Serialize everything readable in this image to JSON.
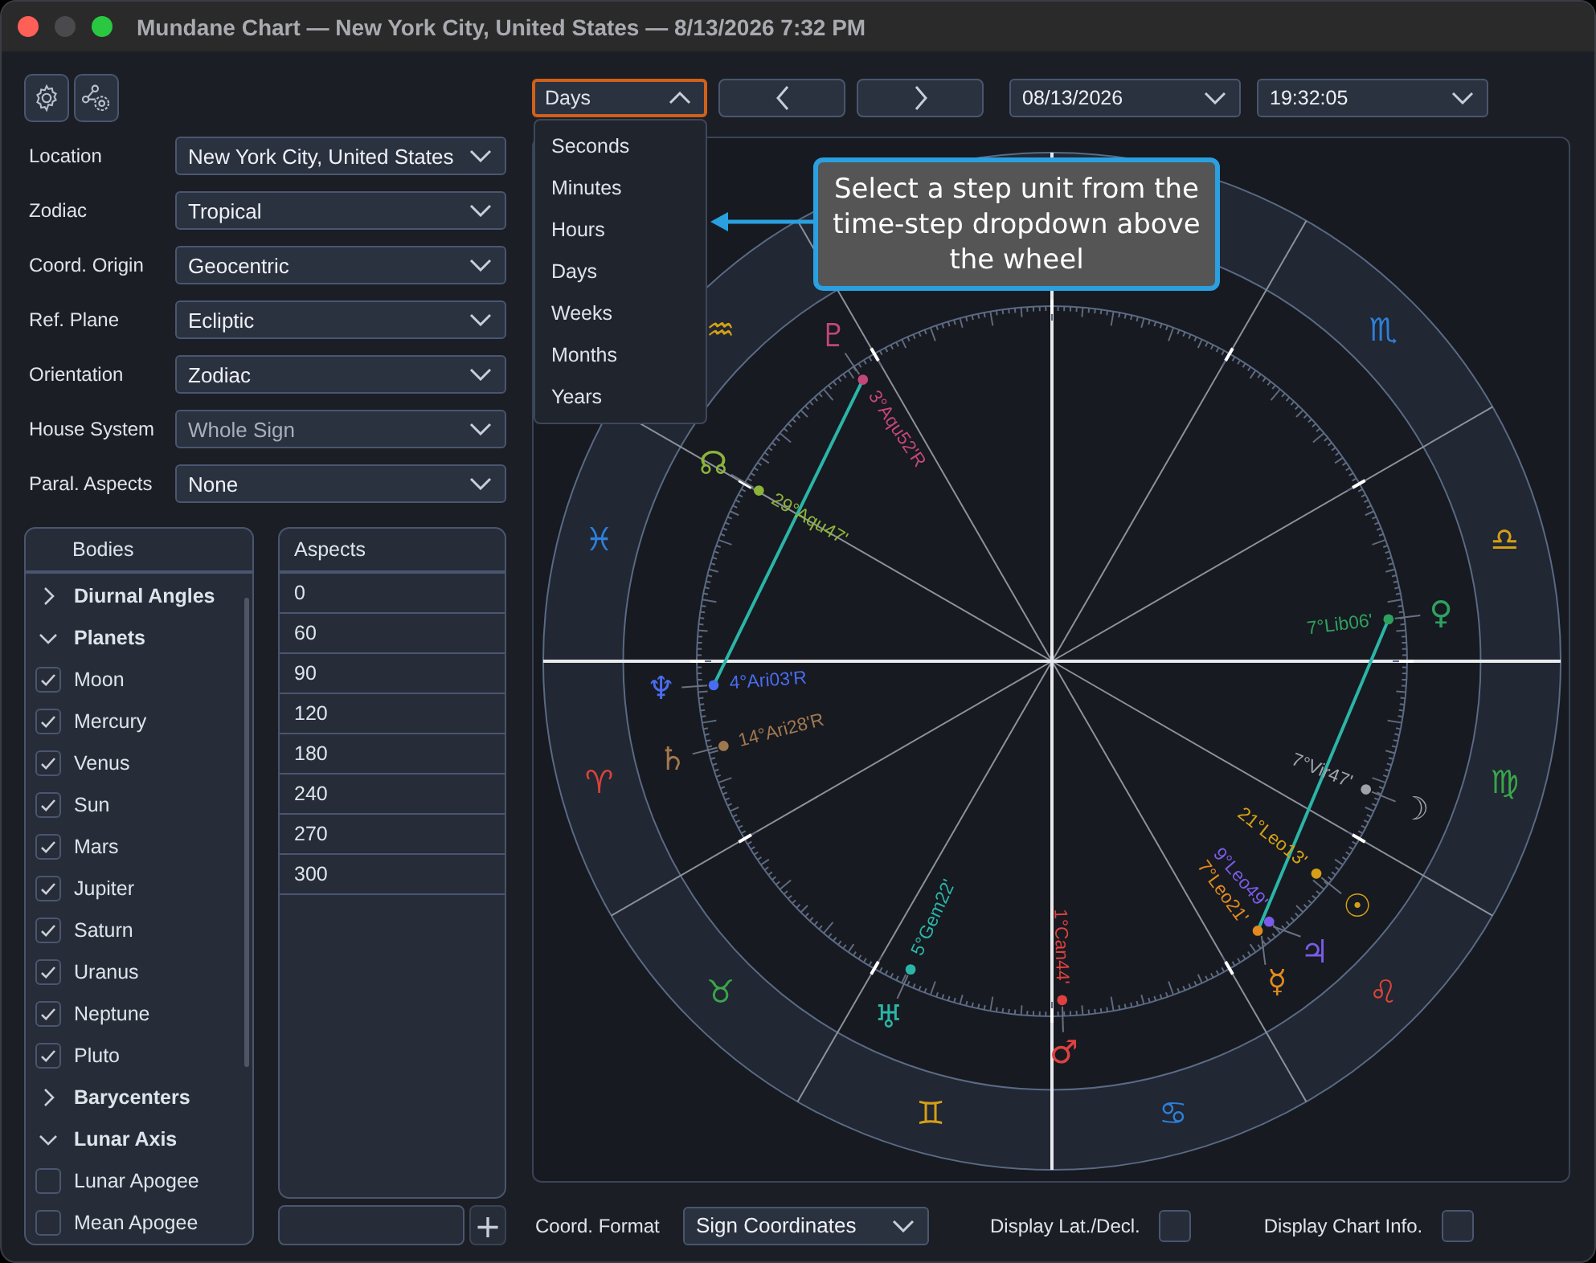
{
  "window": {
    "title": "Mundane Chart — New York City, United States — 8/13/2026 7:32 PM"
  },
  "form": [
    {
      "label": "Location",
      "value": "New York City, United States",
      "disabled": false
    },
    {
      "label": "Zodiac",
      "value": "Tropical",
      "disabled": false
    },
    {
      "label": "Coord. Origin",
      "value": "Geocentric",
      "disabled": false
    },
    {
      "label": "Ref. Plane",
      "value": "Ecliptic",
      "disabled": false
    },
    {
      "label": "Orientation",
      "value": "Zodiac",
      "disabled": false
    },
    {
      "label": "House System",
      "value": "Whole Sign",
      "disabled": true
    },
    {
      "label": "Paral. Aspects",
      "value": "None",
      "disabled": false
    }
  ],
  "bodies": {
    "title": "Bodies",
    "groups": [
      {
        "label": "Diurnal Angles",
        "expanded": false
      },
      {
        "label": "Planets",
        "expanded": true,
        "children": [
          {
            "label": "Moon",
            "checked": true
          },
          {
            "label": "Mercury",
            "checked": true
          },
          {
            "label": "Venus",
            "checked": true
          },
          {
            "label": "Sun",
            "checked": true
          },
          {
            "label": "Mars",
            "checked": true
          },
          {
            "label": "Jupiter",
            "checked": true
          },
          {
            "label": "Saturn",
            "checked": true
          },
          {
            "label": "Uranus",
            "checked": true
          },
          {
            "label": "Neptune",
            "checked": true
          },
          {
            "label": "Pluto",
            "checked": true
          }
        ]
      },
      {
        "label": "Barycenters",
        "expanded": false
      },
      {
        "label": "Lunar Axis",
        "expanded": true,
        "children": [
          {
            "label": "Lunar Apogee",
            "checked": false
          },
          {
            "label": "Mean Apogee",
            "checked": false
          }
        ]
      }
    ]
  },
  "aspects": {
    "title": "Aspects",
    "rows": [
      "0",
      "60",
      "90",
      "120",
      "180",
      "240",
      "270",
      "300"
    ],
    "add_button": "+"
  },
  "toolbar": {
    "step": {
      "value": "Days",
      "open": true,
      "options": [
        "Seconds",
        "Minutes",
        "Hours",
        "Days",
        "Weeks",
        "Months",
        "Years"
      ]
    },
    "date": "08/13/2026",
    "time": "19:32:05"
  },
  "callout": {
    "text": "Select a step unit from the time-step dropdown above the wheel"
  },
  "chart": {
    "signs": [
      {
        "glyph": "♈",
        "color": "#d9443a"
      },
      {
        "glyph": "♉",
        "color": "#3aa54a"
      },
      {
        "glyph": "♊",
        "color": "#d4a017"
      },
      {
        "glyph": "♋",
        "color": "#2f7fd8"
      },
      {
        "glyph": "♌",
        "color": "#d9443a"
      },
      {
        "glyph": "♍",
        "color": "#3aa54a"
      },
      {
        "glyph": "♎",
        "color": "#d4a017"
      },
      {
        "glyph": "♏",
        "color": "#2f7fd8"
      },
      {
        "glyph": "♒",
        "color": "#d4a017"
      },
      {
        "glyph": "♓",
        "color": "#2f7fd8"
      }
    ],
    "planets": [
      {
        "glyph": "♇",
        "label": "3°Aqu52'R",
        "color": "#c2477a"
      },
      {
        "glyph": "☊",
        "label": "29°Aqu47'",
        "color": "#8db33a"
      },
      {
        "glyph": "♆",
        "label": "4°Ari03'R",
        "color": "#4a6cf0"
      },
      {
        "glyph": "♄",
        "label": "14°Ari28'R",
        "color": "#a07850"
      },
      {
        "glyph": "♅",
        "label": "5°Gem22'",
        "color": "#2bb5a8"
      },
      {
        "glyph": "♂",
        "label": "1°Can44'",
        "color": "#e04040"
      },
      {
        "glyph": "☿",
        "label": "7°Leo21'",
        "color": "#e08a20"
      },
      {
        "glyph": "♃",
        "label": "9°Leo49'",
        "color": "#7a5ce8"
      },
      {
        "glyph": "☉",
        "label": "21°Leo13'",
        "color": "#d4a017"
      },
      {
        "glyph": "☽",
        "label": "7°Vir47'",
        "color": "#a0a4aa"
      },
      {
        "glyph": "♀",
        "label": "7°Lib06'",
        "color": "#2fa060"
      }
    ],
    "aspect_lines": [
      {
        "color": "#2bb5a8"
      },
      {
        "color": "#2bb5a8"
      }
    ]
  },
  "footer": {
    "coord_format": {
      "label": "Coord. Format",
      "value": "Sign Coordinates"
    },
    "toggles": [
      {
        "label": "Display Lat./Decl.",
        "checked": false
      },
      {
        "label": "Display Chart Info.",
        "checked": false
      }
    ]
  }
}
